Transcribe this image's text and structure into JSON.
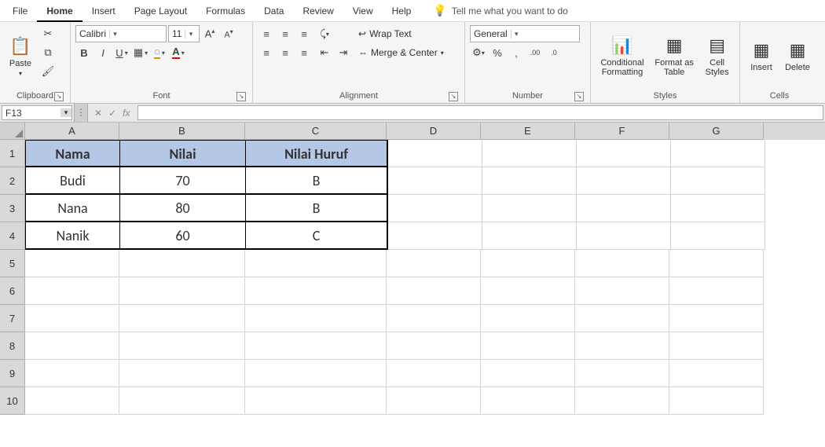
{
  "menu": {
    "items": [
      "File",
      "Home",
      "Insert",
      "Page Layout",
      "Formulas",
      "Data",
      "Review",
      "View",
      "Help"
    ],
    "active": "Home",
    "tell_me": "Tell me what you want to do"
  },
  "ribbon": {
    "clipboard": {
      "paste": "Paste",
      "label": "Clipboard"
    },
    "font": {
      "name": "Calibri",
      "size": "11",
      "label": "Font"
    },
    "alignment": {
      "wrap": "Wrap Text",
      "merge": "Merge & Center",
      "label": "Alignment"
    },
    "number": {
      "format": "General",
      "label": "Number"
    },
    "styles": {
      "conditional": "Conditional Formatting",
      "table": "Format as Table",
      "cell": "Cell Styles",
      "label": "Styles"
    },
    "cells": {
      "insert": "Insert",
      "delete": "Delete",
      "label": "Cells"
    }
  },
  "namebox": "F13",
  "formula": "",
  "columns": [
    "A",
    "B",
    "C",
    "D",
    "E",
    "F",
    "G"
  ],
  "rows": [
    "1",
    "2",
    "3",
    "4",
    "5",
    "6",
    "7",
    "8",
    "9",
    "10"
  ],
  "sheet": {
    "headers": {
      "A": "Nama",
      "B": "Nilai",
      "C": "Nilai Huruf"
    },
    "data": [
      {
        "A": "Budi",
        "B": "70",
        "C": "B"
      },
      {
        "A": "Nana",
        "B": "80",
        "C": "B"
      },
      {
        "A": "Nanik",
        "B": "60",
        "C": "C"
      }
    ]
  }
}
